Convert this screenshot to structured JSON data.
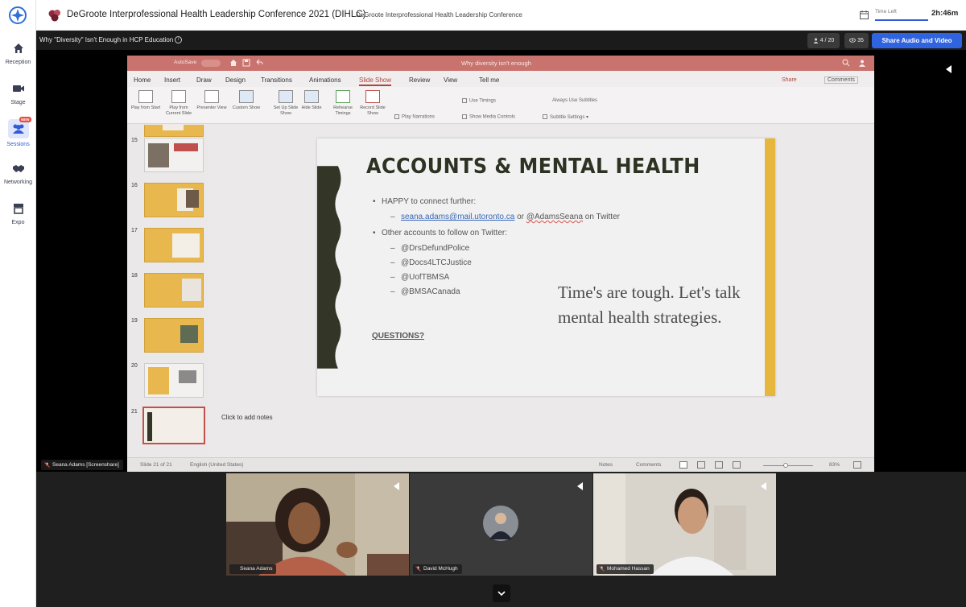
{
  "nav": {
    "items": [
      {
        "label": "Reception",
        "icon": "home-icon"
      },
      {
        "label": "Stage",
        "icon": "video-camera-icon"
      },
      {
        "label": "Sessions",
        "icon": "people-icon",
        "badge": "NEW",
        "active": true
      },
      {
        "label": "Networking",
        "icon": "handshake-icon"
      },
      {
        "label": "Expo",
        "icon": "booth-icon"
      }
    ]
  },
  "header": {
    "title": "DeGroote Interprofessional Health Leadership Conference 2021 (DIHLC)",
    "subtitle": "DeGroote Interprofessional Health Leadership Conference",
    "time_left_label": "Time Left",
    "time_left_value": "2h:46m"
  },
  "session": {
    "title": "Why \"Diversity\" Isn't Enough in HCP Education",
    "info_glyph": "i",
    "attendees": "4 / 20",
    "viewers": "35",
    "share_label": "Share Audio and Video"
  },
  "screenshare_label": "Seana Adams [Screenshare]",
  "ppt": {
    "autosave": "AutoSave",
    "doc_title": "Why diversity isn't enough",
    "tabs": [
      "Home",
      "Insert",
      "Draw",
      "Design",
      "Transitions",
      "Animations",
      "Slide Show",
      "Review",
      "View",
      "Tell me"
    ],
    "active_tab": "Slide Show",
    "share": "Share",
    "comments": "Comments",
    "ribbon_buttons": [
      "Play from Start",
      "Play from Current Slide",
      "Presenter View",
      "Custom Show",
      "Set Up Slide Show",
      "Hide Slide",
      "Rehearse Timings",
      "Record Slide Show"
    ],
    "ribbon_options": {
      "use_timings": "Use Timings",
      "play_narrations": "Play Narrations",
      "show_media_controls": "Show Media Controls",
      "always_use_subtitles": "Always Use Subtitles",
      "subtitle_settings": "Subtitle Settings"
    },
    "thumb_numbers": [
      "15",
      "16",
      "17",
      "18",
      "19",
      "20",
      "21"
    ],
    "notes_placeholder": "Click to add notes",
    "status": {
      "slide": "Slide 21 of 21",
      "language": "English (United States)",
      "notes": "Notes",
      "comments": "Comments",
      "zoom": "83%"
    }
  },
  "slide": {
    "title": "ACCOUNTS & MENTAL HEALTH",
    "bullet1": "HAPPY to connect further:",
    "email": "seana.adams@mail.utoronto.ca",
    "or_text": "or",
    "handle_user": "@AdamsSeana",
    "on_twitter": "on Twitter",
    "bullet2": "Other accounts to follow on Twitter:",
    "accounts": [
      "@DrsDefundPolice",
      "@Docs4LTCJustice",
      "@UofTBMSA",
      "@BMSACanada"
    ],
    "questions": "QUESTIONS?",
    "callout": "Time's are tough. Let's talk mental health strategies."
  },
  "participants": [
    {
      "name": "Seana Adams"
    },
    {
      "name": "David McHugh"
    },
    {
      "name": "Mohamed Hassan"
    }
  ]
}
